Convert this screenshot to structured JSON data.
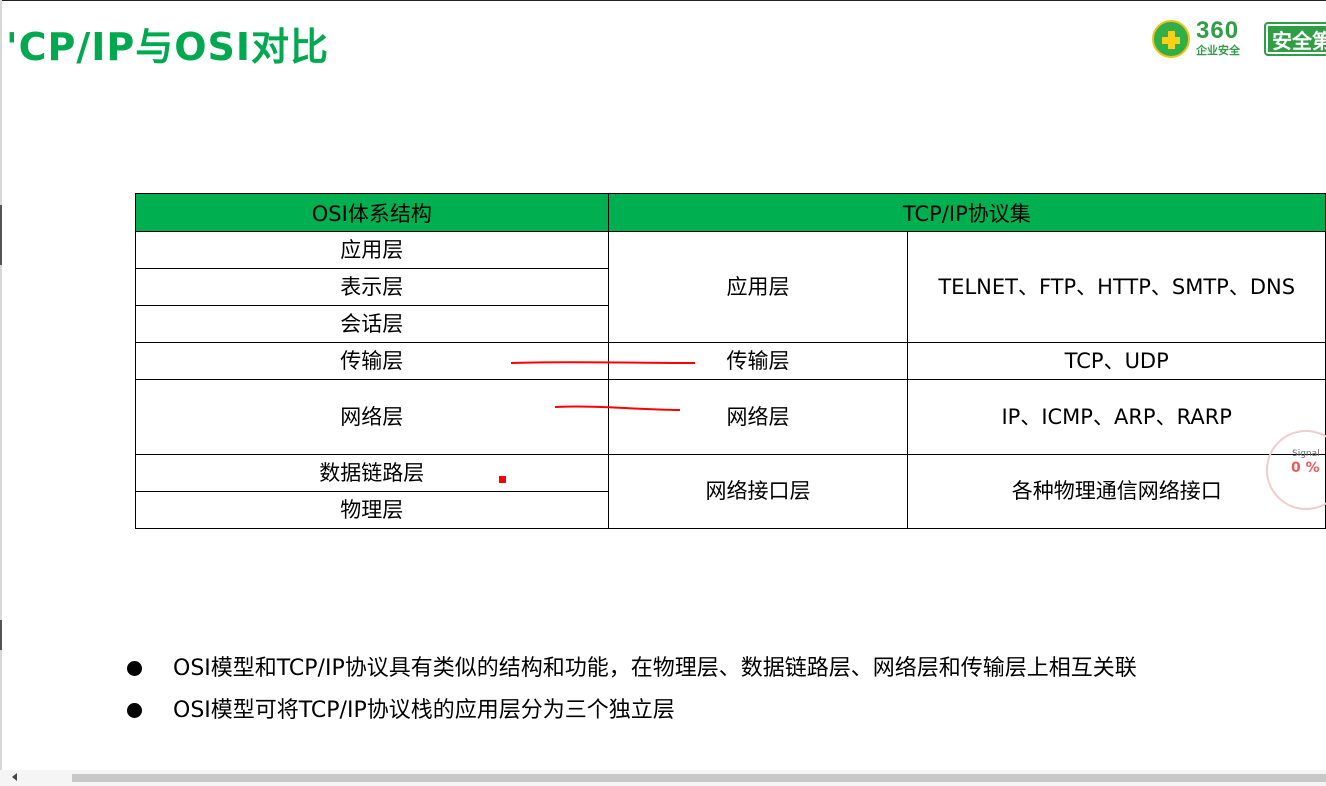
{
  "slide": {
    "title": "'CP/IP与OSI对比"
  },
  "logo": {
    "brand_number": "360",
    "brand_sub": "企业安全",
    "badge": "安全第"
  },
  "table": {
    "headers": [
      "OSI体系结构",
      "TCP/IP协议集"
    ],
    "osi_layers": [
      "应用层",
      "表示层",
      "会话层",
      "传输层",
      "网络层",
      "数据链路层",
      "物理层"
    ],
    "tcpip_layers": [
      "应用层",
      "传输层",
      "网络层",
      "网络接口层"
    ],
    "protocols": [
      "TELNET、FTP、HTTP、SMTP、DNS",
      "TCP、UDP",
      "IP、ICMP、ARP、RARP",
      "各种物理通信网络接口"
    ]
  },
  "bullets": [
    "OSI模型和TCP/IP协议具有类似的结构和功能，在物理层、数据链路层、网络层和传输层上相互关联",
    "OSI模型可将TCP/IP协议栈的应用层分为三个独立层"
  ],
  "signal_widget": {
    "label": "Signal",
    "value": "0 %"
  },
  "colors": {
    "title_green": "#00a950",
    "header_green": "#00b050",
    "annotation_red": "#ff0000"
  }
}
